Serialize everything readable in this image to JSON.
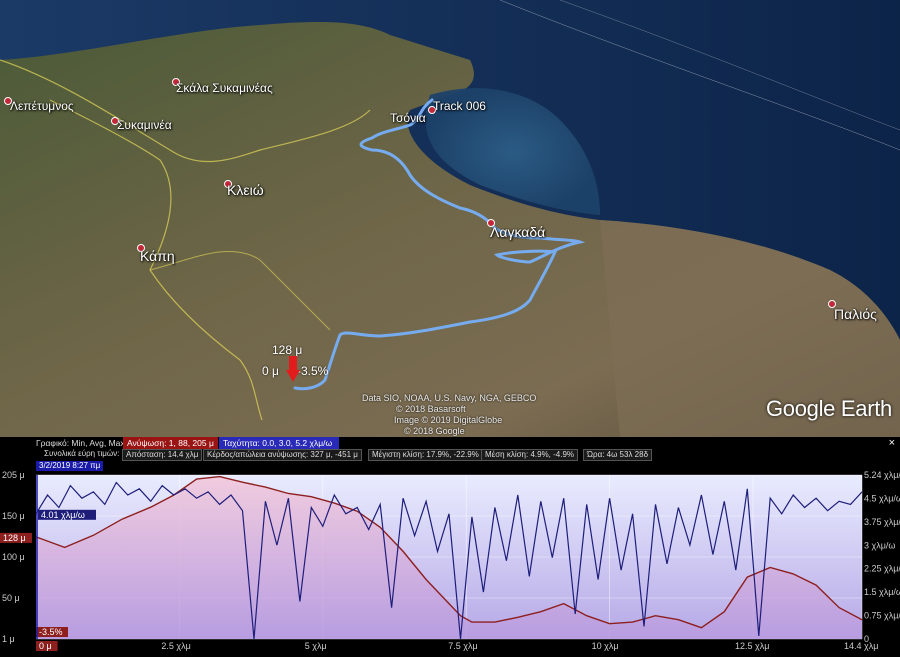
{
  "map": {
    "places": [
      {
        "id": "lepetymnos",
        "name": "Λεπέτυμνος"
      },
      {
        "id": "skala",
        "name": "Σκάλα Συκαμινέας"
      },
      {
        "id": "sykaminea",
        "name": "Συκαμινέα"
      },
      {
        "id": "kleio",
        "name": "Κλειώ"
      },
      {
        "id": "kapi",
        "name": "Κάπη"
      },
      {
        "id": "tsonia",
        "name": "Τσόνια"
      },
      {
        "id": "lagkada",
        "name": "Λαγκαδά"
      },
      {
        "id": "palios",
        "name": "Παλιός"
      },
      {
        "id": "track",
        "name": "Track 006"
      }
    ],
    "cursor": {
      "elevation": "128 μ",
      "start": "0 μ",
      "slope": "-3.5%"
    },
    "credits": [
      "Data SIO, NOAA, U.S. Navy, NGA, GEBCO",
      "© 2018 Basarsoft",
      "Image © 2019 DigitalGlobe",
      "© 2018 Google"
    ],
    "logo": "Google Earth"
  },
  "panel": {
    "graph_label": "Γραφικό: Min, Avg, Max",
    "elev_pill": "Ανύψωση: 1, 88, 205 μ",
    "speed_pill": "Ταχύτητα: 0.0, 3.0, 5.2 χλμ/ω",
    "totals_label": "Συνολικά εύρη τιμών:",
    "distance": "Απόσταση: 14.4 χλμ",
    "gain": "Κέρδος/απώλεια ανύψωσης: 327 μ, -451 μ",
    "max_slope": "Μέγιστη κλίση: 17.9%, -22.9%",
    "avg_slope": "Μέση κλίση: 4.9%, -4.9%",
    "time": "Ώρα: 4ω 53λ 28δ",
    "date": "3/2/2019 8:27 πμ",
    "close": "×"
  },
  "colors": {
    "track": "#6fa6e8",
    "elevation": "#8e1f1f",
    "speed": "#1e1e7a",
    "elev_pill": "#9a1414",
    "speed_pill": "#2a2ab8"
  },
  "chart_data": {
    "type": "area",
    "x_unit": "χλμ",
    "x_range": [
      0,
      14.4
    ],
    "x_tick_labels": [
      "2.5 χλμ",
      "5 χλμ",
      "7.5 χλμ",
      "10 χλμ",
      "12.5 χλμ",
      "14.4 χλμ"
    ],
    "y_left_ticks": [
      "205 μ",
      "150 μ",
      "100 μ",
      "50 μ",
      "1 μ"
    ],
    "y_right_ticks": [
      "5.24 χλμ/ω",
      "4.5 χλμ/ω",
      "3.75 χλμ/ω",
      "3 χλμ/ω",
      "2.25 χλμ/ω",
      "1.5 χλμ/ω",
      "0.75 χλμ/ω",
      "0"
    ],
    "y_left_range": [
      1,
      205
    ],
    "y_right_range": [
      0,
      5.24
    ],
    "markers": {
      "start_elev": "128 μ",
      "start_speed": "4.01 χλμ/ω",
      "start_dist": "0 μ",
      "slope": "-3.5%"
    },
    "series": [
      {
        "name": "Ανύψωση",
        "x": [
          0,
          0.5,
          1,
          1.5,
          2,
          2.4,
          2.8,
          3.2,
          3.6,
          4,
          4.4,
          4.8,
          5.2,
          5.6,
          6,
          6.4,
          6.8,
          7.2,
          7.4,
          7.6,
          8,
          8.4,
          8.8,
          9.2,
          9.6,
          10,
          10.4,
          10.8,
          11.2,
          11.6,
          12,
          12.4,
          12.8,
          13.2,
          13.6,
          14,
          14.4
        ],
        "values": [
          128,
          115,
          130,
          150,
          165,
          180,
          200,
          203,
          196,
          190,
          182,
          178,
          170,
          160,
          140,
          110,
          75,
          45,
          30,
          22,
          22,
          28,
          35,
          45,
          30,
          20,
          22,
          30,
          25,
          15,
          35,
          78,
          90,
          82,
          68,
          40,
          25
        ]
      },
      {
        "name": "Ταχύτητα",
        "x": [
          0,
          0.2,
          0.4,
          0.6,
          0.8,
          1,
          1.2,
          1.4,
          1.6,
          1.8,
          2,
          2.2,
          2.4,
          2.6,
          2.8,
          3,
          3.2,
          3.4,
          3.6,
          3.8,
          4,
          4.2,
          4.4,
          4.6,
          4.8,
          5,
          5.2,
          5.4,
          5.6,
          5.8,
          6,
          6.2,
          6.4,
          6.6,
          6.8,
          7,
          7.2,
          7.4,
          7.6,
          7.8,
          8,
          8.2,
          8.4,
          8.6,
          8.8,
          9,
          9.2,
          9.4,
          9.6,
          9.8,
          10,
          10.2,
          10.4,
          10.6,
          10.8,
          11,
          11.2,
          11.4,
          11.6,
          11.8,
          12,
          12.2,
          12.4,
          12.6,
          12.8,
          13,
          13.2,
          13.4,
          13.6,
          13.8,
          14,
          14.2,
          14.4
        ],
        "values": [
          4.0,
          4.6,
          4.2,
          4.9,
          4.5,
          4.7,
          4.3,
          5.0,
          4.6,
          4.8,
          4.4,
          4.9,
          4.6,
          4.8,
          4.5,
          4.7,
          4.3,
          4.6,
          4.1,
          0.0,
          4.4,
          3.0,
          4.5,
          1.2,
          4.2,
          3.6,
          4.6,
          4.0,
          4.2,
          3.5,
          4.3,
          1.0,
          4.5,
          3.3,
          4.4,
          2.8,
          4.0,
          0.0,
          3.9,
          1.5,
          4.2,
          2.5,
          4.6,
          2.0,
          4.4,
          2.6,
          4.5,
          0.8,
          4.3,
          1.9,
          4.5,
          2.2,
          4.0,
          0.4,
          4.3,
          2.4,
          4.2,
          3.0,
          4.6,
          2.7,
          4.4,
          2.2,
          4.8,
          0.1,
          4.5,
          4.0,
          4.6,
          4.2,
          4.5,
          4.1,
          4.4,
          4.3,
          4.7
        ]
      }
    ]
  }
}
